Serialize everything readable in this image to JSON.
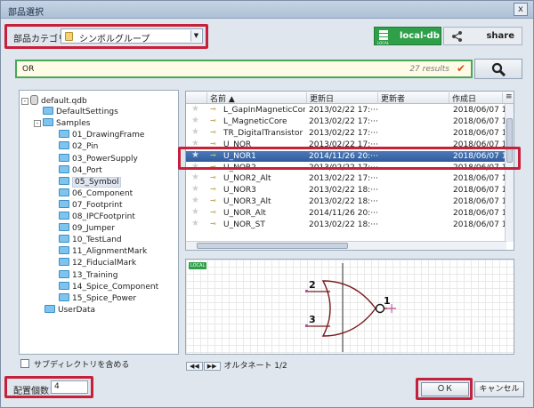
{
  "window": {
    "title": "部品選択",
    "close_glyph": "x"
  },
  "category": {
    "label": "部品カテゴリ",
    "value": "シンボルグループ"
  },
  "db": {
    "local_label": "local-db",
    "local_small": "LOCAL",
    "share_label": "share"
  },
  "search": {
    "query": "OR",
    "results": "27 results"
  },
  "tree": [
    {
      "label": "default.qdb",
      "level": 0,
      "type": "db",
      "expander": "-"
    },
    {
      "label": "DefaultSettings",
      "level": 1,
      "type": "folder"
    },
    {
      "label": "Samples",
      "level": 1,
      "type": "folder",
      "expander": "-"
    },
    {
      "label": "01_DrawingFrame",
      "level": 2,
      "type": "folder"
    },
    {
      "label": "02_Pin",
      "level": 2,
      "type": "folder"
    },
    {
      "label": "03_PowerSupply",
      "level": 2,
      "type": "folder"
    },
    {
      "label": "04_Port",
      "level": 2,
      "type": "folder"
    },
    {
      "label": "05_Symbol",
      "level": 2,
      "type": "folder",
      "selected": true
    },
    {
      "label": "06_Component",
      "level": 2,
      "type": "folder"
    },
    {
      "label": "07_Footprint",
      "level": 2,
      "type": "folder"
    },
    {
      "label": "08_IPCFootprint",
      "level": 2,
      "type": "folder"
    },
    {
      "label": "09_Jumper",
      "level": 2,
      "type": "folder"
    },
    {
      "label": "10_TestLand",
      "level": 2,
      "type": "folder"
    },
    {
      "label": "11_AlignmentMark",
      "level": 2,
      "type": "folder"
    },
    {
      "label": "12_FiducialMark",
      "level": 2,
      "type": "folder"
    },
    {
      "label": "13_Training",
      "level": 2,
      "type": "folder"
    },
    {
      "label": "14_Spice_Component",
      "level": 2,
      "type": "folder"
    },
    {
      "label": "15_Spice_Power",
      "level": 2,
      "type": "folder"
    },
    {
      "label": "UserData",
      "level": 1,
      "type": "folder"
    }
  ],
  "subdir_label": "サブディレクトリを含める",
  "grid": {
    "columns": [
      "名前 ▲",
      "更新日",
      "更新者",
      "作成日"
    ],
    "rows": [
      {
        "name": "L_GapInMagneticCore",
        "updated": "2013/02/22 17:···",
        "updater": "",
        "created": "2018/06/07 1"
      },
      {
        "name": "L_MagneticCore",
        "updated": "2013/02/22 17:···",
        "updater": "",
        "created": "2018/06/07 1"
      },
      {
        "name": "TR_DigitalTransistor",
        "updated": "2013/02/22 17:···",
        "updater": "",
        "created": "2018/06/07 1"
      },
      {
        "name": "U_NOR",
        "updated": "2013/02/22 17:···",
        "updater": "",
        "created": "2018/06/07 1"
      },
      {
        "name": "U_NOR1",
        "updated": "2014/11/26 20:···",
        "updater": "",
        "created": "2018/06/07 1",
        "selected": true
      },
      {
        "name": "U_NOR2",
        "updated": "2013/02/22 17:···",
        "updater": "",
        "created": "2018/06/07 1"
      },
      {
        "name": "U_NOR2_Alt",
        "updated": "2013/02/22 17:···",
        "updater": "",
        "created": "2018/06/07 1"
      },
      {
        "name": "U_NOR3",
        "updated": "2013/02/22 18:···",
        "updater": "",
        "created": "2018/06/07 1"
      },
      {
        "name": "U_NOR3_Alt",
        "updated": "2013/02/22 18:···",
        "updater": "",
        "created": "2018/06/07 1"
      },
      {
        "name": "U_NOR_Alt",
        "updated": "2014/11/26 20:···",
        "updater": "",
        "created": "2018/06/07 1"
      },
      {
        "name": "U_NOR_ST",
        "updated": "2013/02/22 18:···",
        "updater": "",
        "created": "2018/06/07 1"
      }
    ]
  },
  "preview": {
    "badge": "LOCAL",
    "pins": [
      "2",
      "3",
      "1"
    ]
  },
  "alternate": {
    "label": "オルタネート 1/2"
  },
  "count": {
    "label": "配置個数：",
    "value": "4"
  },
  "buttons": {
    "ok": "ＯＫ",
    "cancel": "キャンセル"
  },
  "colors": {
    "highlight": "#c6203a",
    "local_db": "#2f9f4a",
    "selection": "#2f5d9d",
    "symbol": "#7a1a1a"
  }
}
